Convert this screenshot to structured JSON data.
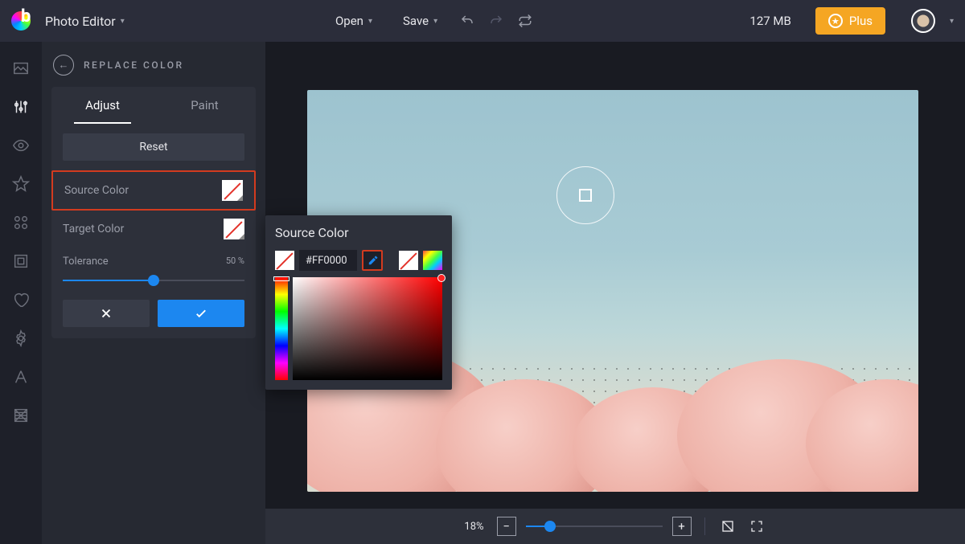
{
  "header": {
    "app_name": "Photo Editor",
    "open": "Open",
    "save": "Save",
    "memory": "127 MB",
    "plus": "Plus"
  },
  "panel": {
    "title": "REPLACE COLOR",
    "tab_adjust": "Adjust",
    "tab_paint": "Paint",
    "reset": "Reset",
    "source_color": "Source Color",
    "target_color": "Target Color",
    "tolerance": "Tolerance",
    "tolerance_value": "50 %"
  },
  "picker": {
    "title": "Source Color",
    "hex": "#FF0000"
  },
  "bottom": {
    "zoom_label": "18%",
    "zoom_percent": 18,
    "minus": "−",
    "plus": "+"
  },
  "colors": {
    "hex": "#FF0000"
  }
}
